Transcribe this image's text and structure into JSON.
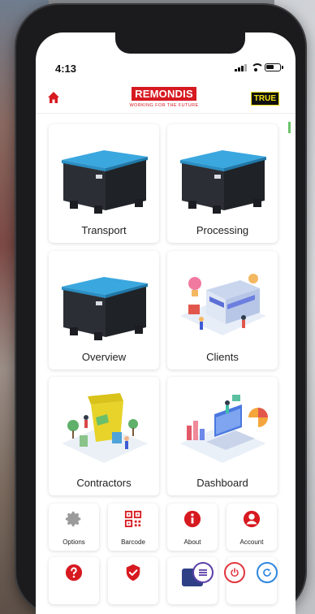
{
  "status_bar": {
    "time": "4:13"
  },
  "header": {
    "logo_text": "REMONDIS",
    "logo_tagline": "WORKING FOR THE FUTURE",
    "badge": "TRUE",
    "home_icon": "home-icon"
  },
  "tiles": [
    {
      "label": "Transport",
      "art": "crate-image"
    },
    {
      "label": "Processing",
      "art": "crate-image"
    },
    {
      "label": "Overview",
      "art": "crate-image"
    },
    {
      "label": "Clients",
      "art": "store-illustration"
    },
    {
      "label": "Contractors",
      "art": "recycling-illustration"
    },
    {
      "label": "Dashboard",
      "art": "analytics-illustration"
    }
  ],
  "quick_buttons": [
    {
      "label": "Options",
      "icon": "gear-icon"
    },
    {
      "label": "Barcode",
      "icon": "qr-code-icon"
    },
    {
      "label": "About",
      "icon": "info-icon"
    },
    {
      "label": "Account",
      "icon": "user-icon"
    },
    {
      "label": "",
      "icon": "help-icon"
    },
    {
      "label": "",
      "icon": "shield-check-icon"
    }
  ],
  "floating_buttons": [
    {
      "icon": "menu-icon"
    },
    {
      "icon": "power-icon"
    },
    {
      "icon": "refresh-icon"
    }
  ],
  "colors": {
    "brand_red": "#d71920",
    "crate_blue": "#3aa7df",
    "crate_body": "#2b2f35",
    "menu_purple": "#5b3fa8",
    "power_red": "#e0363e",
    "refresh_blue": "#2e86de"
  }
}
